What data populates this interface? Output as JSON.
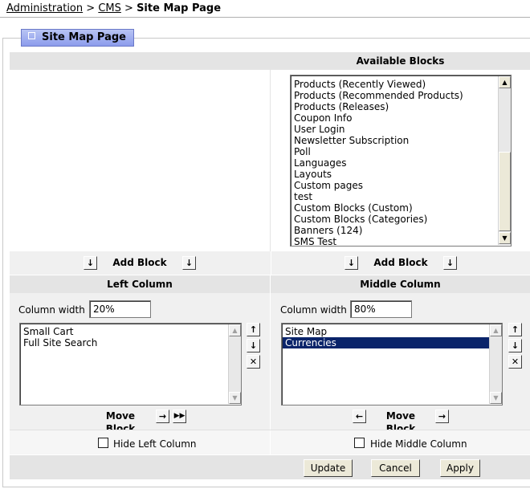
{
  "breadcrumb": {
    "items": [
      "Administration",
      "CMS"
    ],
    "separator": ">",
    "current": "Site Map Page"
  },
  "page_title": "Site Map Page",
  "available_blocks": {
    "header": "Available Blocks",
    "items": [
      "Products (Recently Viewed)",
      "Products (Recommended Products)",
      "Products (Releases)",
      "Coupon Info",
      "User Login",
      "Newsletter Subscription",
      "Poll",
      "Languages",
      "Layouts",
      "Custom pages",
      "test",
      "Custom Blocks (Custom)",
      "Custom Blocks (Categories)",
      "Banners (124)",
      "SMS Test"
    ]
  },
  "add_block_label": "Add Block",
  "left_column": {
    "header": "Left Column",
    "width_label": "Column width",
    "width_value": "20%",
    "items": [
      "Small Cart",
      "Full Site Search"
    ],
    "selected_index": -1,
    "move_label": "Move Block",
    "hide_label": "Hide Left Column"
  },
  "middle_column": {
    "header": "Middle Column",
    "width_label": "Column width",
    "width_value": "80%",
    "items": [
      "Site Map",
      "Currencies"
    ],
    "selected_index": 1,
    "move_label": "Move Block",
    "hide_label": "Hide Middle Column"
  },
  "buttons": {
    "update": "Update",
    "cancel": "Cancel",
    "apply": "Apply"
  },
  "colors": {
    "header_bg": "#e4e4e4",
    "selection": "#0a246a",
    "title_tab": "#8c9cec"
  }
}
